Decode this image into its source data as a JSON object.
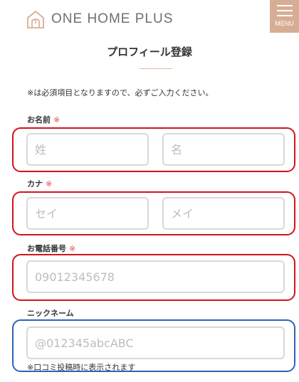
{
  "header": {
    "logo_text": "ONE HOME PLUS",
    "menu_label": "MENU"
  },
  "page_title": "プロフィール登録",
  "notice": "※は必須項目となりますので、必ずご入力ください。",
  "required_mark": "※",
  "fields": {
    "name": {
      "label": "お名前",
      "last_placeholder": "姓",
      "first_placeholder": "名"
    },
    "kana": {
      "label": "カナ",
      "last_placeholder": "セイ",
      "first_placeholder": "メイ"
    },
    "phone": {
      "label": "お電話番号",
      "placeholder": "09012345678"
    },
    "nickname": {
      "label": "ニックネーム",
      "placeholder": "@012345abcABC",
      "helper": "※口コミ投稿時に表示されます"
    }
  },
  "colors": {
    "accent": "#d6ad94",
    "required": "#e0464f",
    "highlight_red": "#d1141b",
    "highlight_blue": "#2c63b8"
  }
}
